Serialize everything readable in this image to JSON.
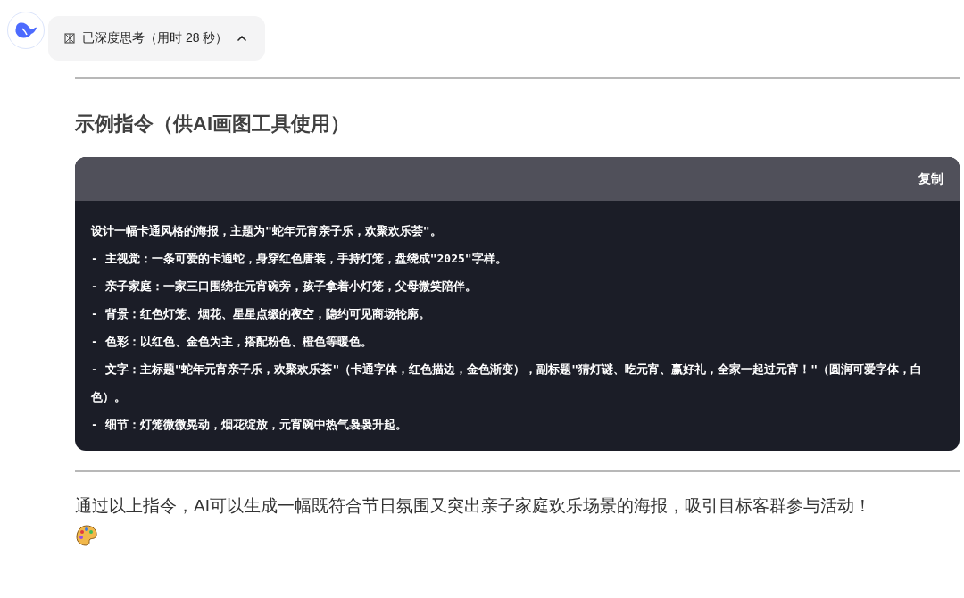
{
  "thinking": {
    "label": "已深度思考（用时 28 秒）",
    "expanded": true
  },
  "heading": "示例指令（供AI画图工具使用）",
  "code_block": {
    "copy_label": "复制",
    "lines": [
      "设计一幅卡通风格的海报，主题为\"蛇年元宵亲子乐，欢聚欢乐荟\"。",
      "- 主视觉：一条可爱的卡通蛇，身穿红色唐装，手持灯笼，盘绕成\"2025\"字样。",
      "- 亲子家庭：一家三口围绕在元宵碗旁，孩子拿着小灯笼，父母微笑陪伴。",
      "- 背景：红色灯笼、烟花、星星点缀的夜空，隐约可见商场轮廓。",
      "- 色彩：以红色、金色为主，搭配粉色、橙色等暖色。",
      "- 文字：主标题\"蛇年元宵亲子乐，欢聚欢乐荟\"（卡通字体，红色描边，金色渐变），副标题\"猜灯谜、吃元宵、赢好礼，全家一起过元宵！\"（圆润可爱字体，白色）。",
      "- 细节：灯笼微微晃动，烟花绽放，元宵碗中热气袅袅升起。"
    ]
  },
  "summary": "通过以上指令，AI可以生成一幅既符合节日氛围又突出亲子家庭欢乐场景的海报，吸引目标客群参与活动！"
}
